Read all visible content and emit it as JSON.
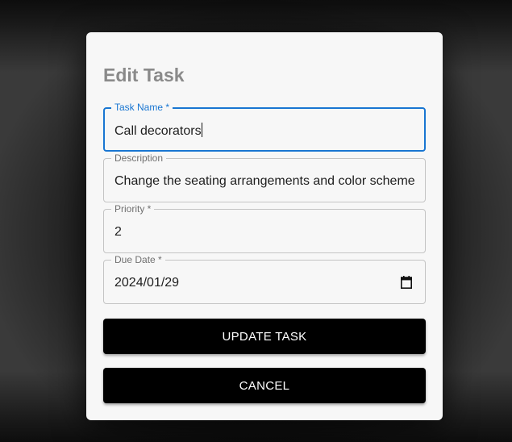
{
  "dialog": {
    "title": "Edit Task",
    "fields": {
      "task_name": {
        "label": "Task Name *",
        "value": "Call decorators"
      },
      "description": {
        "label": "Description",
        "value": "Change the seating arrangements and color scheme"
      },
      "priority": {
        "label": "Priority *",
        "value": "2"
      },
      "due_date": {
        "label": "Due Date *",
        "value": "2024/01/29"
      }
    },
    "buttons": {
      "update": "UPDATE TASK",
      "cancel": "CANCEL"
    }
  },
  "colors": {
    "focus_accent": "#1976d2",
    "button_bg": "#000000",
    "dialog_bg": "#f7f7f7"
  },
  "icons": {
    "due_date": "calendar-icon"
  }
}
